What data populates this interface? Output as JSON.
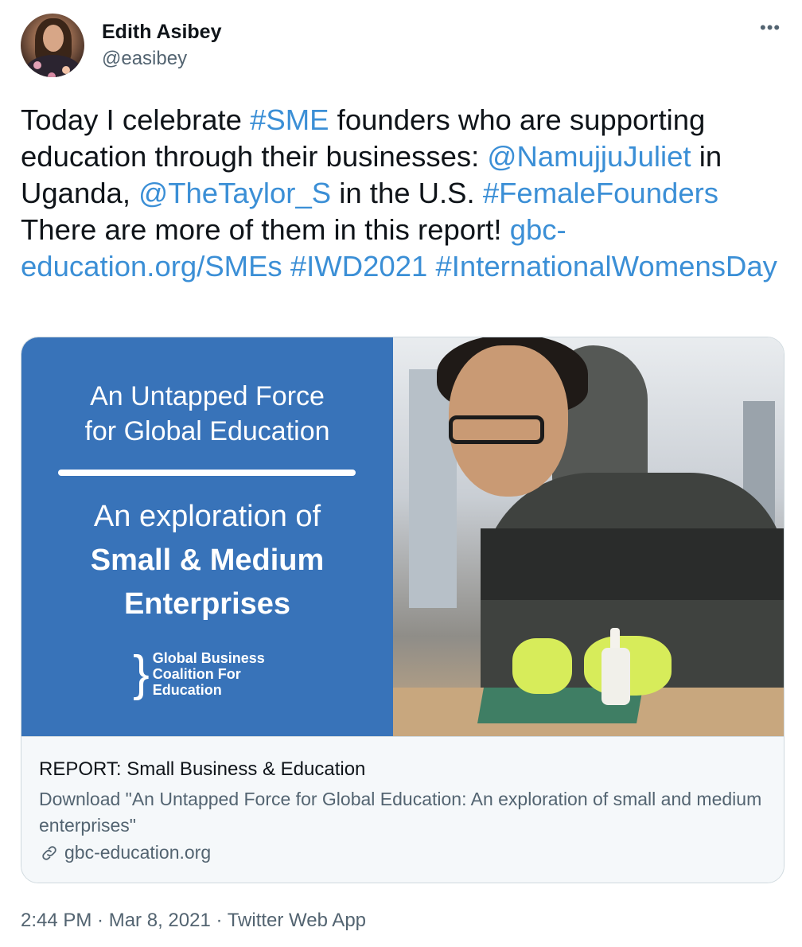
{
  "author": {
    "name": "Edith Asibey",
    "handle": "@easibey",
    "avatar_icon": "avatar-photo"
  },
  "more_icon": "more-options-icon",
  "tweet": {
    "segments": [
      {
        "t": "Today I celebrate ",
        "link": false
      },
      {
        "t": "#SME",
        "link": true
      },
      {
        "t": " founders who are supporting education through their businesses: ",
        "link": false
      },
      {
        "t": "@NamujjuJuliet",
        "link": true
      },
      {
        "t": " in Uganda, ",
        "link": false
      },
      {
        "t": "@TheTaylor_S",
        "link": true
      },
      {
        "t": " in the U.S. ",
        "link": false
      },
      {
        "t": "#FemaleFounders",
        "link": true
      },
      {
        "t": " There are more of them in this report! ",
        "link": false
      },
      {
        "t": "gbc-education.org/SMEs",
        "link": true
      },
      {
        "t": " ",
        "link": false
      },
      {
        "t": "#IWD2021",
        "link": true
      },
      {
        "t": " ",
        "link": false
      },
      {
        "t": "#InternationalWomensDay",
        "link": true
      }
    ]
  },
  "card": {
    "image": {
      "heading_line1": "An Untapped Force",
      "heading_line2": "for Global Education",
      "sub_line1": "An exploration of",
      "sub_line2": "Small & Medium",
      "sub_line3": "Enterprises",
      "org_line1": "Global Business",
      "org_line2": "Coalition For",
      "org_line3": "Education",
      "bg_color": "#3873b9"
    },
    "title": "REPORT: Small Business & Education",
    "description": "Download \"An Untapped Force for Global Education: An exploration of small and medium enterprises\"",
    "domain": "gbc-education.org",
    "domain_icon": "link-icon"
  },
  "meta": {
    "time": "2:44 PM",
    "sep1": " · ",
    "date": "Mar 8, 2021",
    "sep2": " · ",
    "app": "Twitter Web App"
  },
  "colors": {
    "link": "#3b8fd6",
    "text": "#0f1419",
    "secondary": "#536471"
  }
}
